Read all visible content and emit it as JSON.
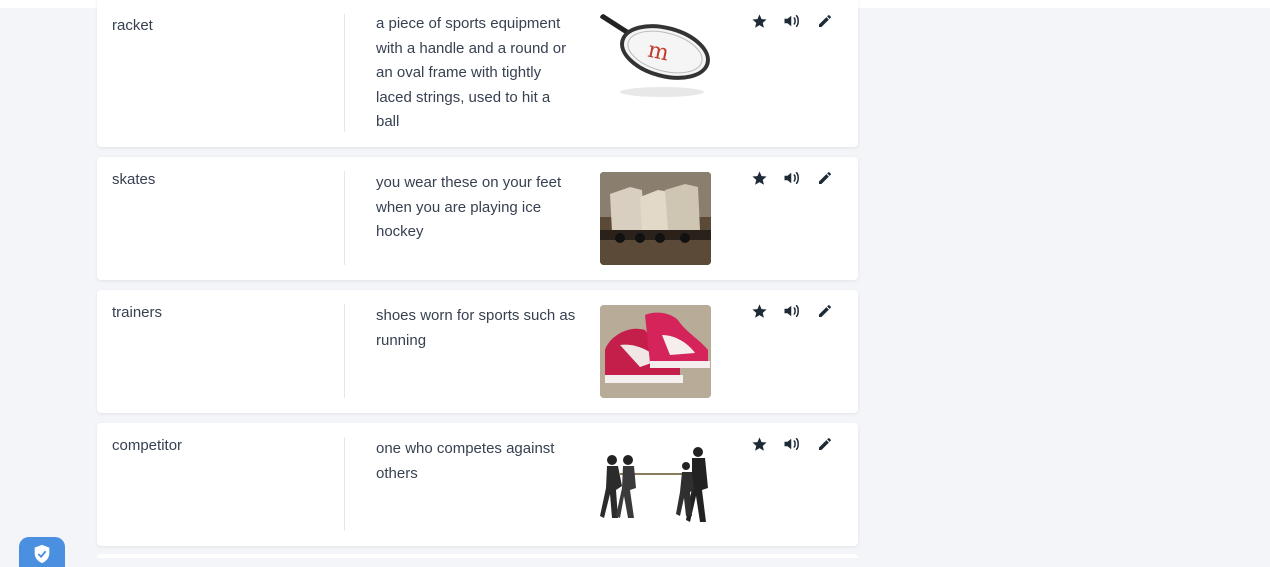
{
  "colors": {
    "page_background": "#f3f5f9",
    "card_background": "#ffffff",
    "icon_color": "#1f2a37",
    "badge_color": "#4a8fe0"
  },
  "actions": {
    "favorite_icon": "star-icon",
    "audio_icon": "speaker-icon",
    "edit_icon": "pencil-icon"
  },
  "entries": [
    {
      "word": "racket",
      "definition": "a piece of sports equipment with a handle and a round or an oval frame with tightly laced strings, used to hit a ball",
      "image": "tennis-racket"
    },
    {
      "word": "skates",
      "definition": "you wear these on your feet when you are playing ice hockey",
      "image": "roller-skates"
    },
    {
      "word": "trainers",
      "definition": "shoes worn for sports such as running",
      "image": "red-sneakers"
    },
    {
      "word": "competitor",
      "definition": "one who competes against others",
      "image": "tug-of-war"
    }
  ]
}
